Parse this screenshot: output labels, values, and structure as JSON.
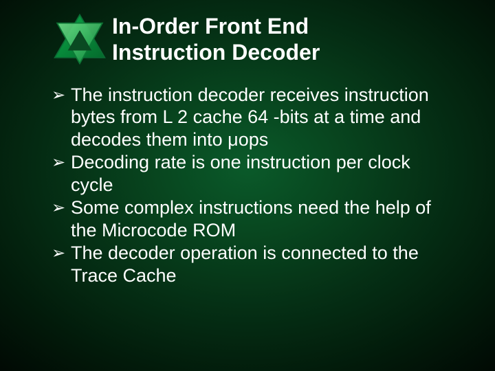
{
  "title": {
    "line1": "In-Order Front End",
    "line2": "Instruction Decoder"
  },
  "bullets": [
    "The instruction decoder receives instruction bytes from L 2 cache 64 -bits at a time and decodes them into μops",
    "Decoding rate is one instruction per clock cycle",
    "Some complex instructions need the help of the Microcode ROM",
    "The decoder operation is connected to the Trace Cache"
  ],
  "bullet_glyph": "➢",
  "decor": {
    "outer_color1": "#0aa848",
    "outer_color2": "#046a2c",
    "outer_stroke": "#0b6b34",
    "inner_color1": "#6fe08a",
    "inner_color2": "#0a8a3a",
    "inner_stroke": "#0e7a38",
    "core_fill": "#0a4a22"
  }
}
